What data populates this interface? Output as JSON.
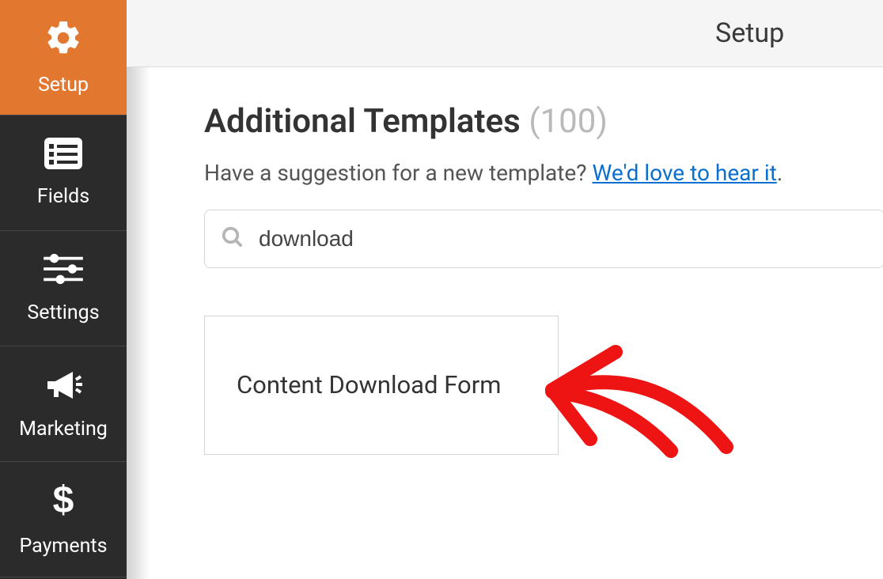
{
  "sidebar": {
    "items": [
      {
        "label": "Setup"
      },
      {
        "label": "Fields"
      },
      {
        "label": "Settings"
      },
      {
        "label": "Marketing"
      },
      {
        "label": "Payments"
      }
    ]
  },
  "topbar": {
    "title": "Setup"
  },
  "main": {
    "heading": "Additional Templates",
    "heading_count": "(100)",
    "subtitle_prefix": "Have a suggestion for a new template? ",
    "subtitle_link": "We'd love to hear it",
    "subtitle_suffix": ".",
    "search_value": "download",
    "template_name": "Content Download Form"
  }
}
